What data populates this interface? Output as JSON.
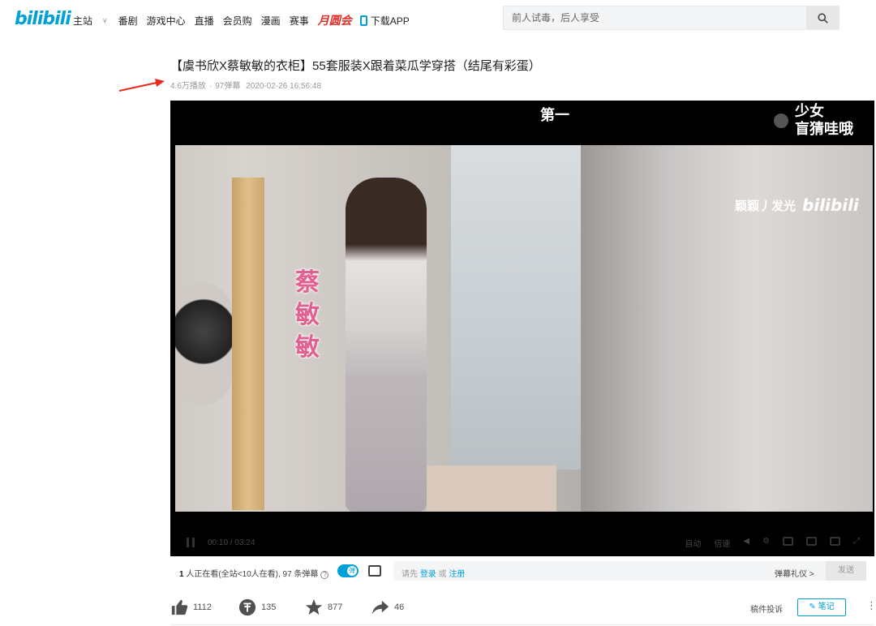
{
  "header": {
    "logo": "bilibili",
    "nav": [
      {
        "label": "主站",
        "has_dropdown": true
      },
      {
        "label": "番剧"
      },
      {
        "label": "游戏中心"
      },
      {
        "label": "直播"
      },
      {
        "label": "会员购"
      },
      {
        "label": "漫画"
      },
      {
        "label": "赛事"
      }
    ],
    "special_label": "月圆会",
    "download_label": "下载APP",
    "search_placeholder": "前人试毒，后人享受"
  },
  "video": {
    "title": "【虞书欣X蔡敏敏的衣柜】55套服装X跟着菜瓜学穿搭（结尾有彩蛋）",
    "views": "4.6万播放",
    "danmaku_count": "97弹幕",
    "date": "2020-02-26 16:56:48"
  },
  "player": {
    "caption_top": "第一",
    "caption_right_line1": "少女",
    "caption_right_line2": "盲猜哇哦",
    "watermark_text": "颖颖丿发光",
    "watermark_logo": "bilibili",
    "name_overlay": "蔡敏敏",
    "time_current": "00:10",
    "time_total": "03:24",
    "auto_label": "自动",
    "speed_label": "倍速"
  },
  "danmaku": {
    "viewers_count": "1",
    "viewers_text": "人正在看(全站<10人在看), 97 条弹幕",
    "toggle_label": "弹",
    "prompt_prefix": "请先",
    "login_label": "登录",
    "or_label": "或",
    "register_label": "注册",
    "etiquette_label": "弹幕礼仪 >",
    "send_label": "发送"
  },
  "actions": {
    "like_count": "1112",
    "coin_count": "135",
    "favorite_count": "877",
    "share_count": "46",
    "report_label": "稿件投诉",
    "note_label": "笔记"
  },
  "colors": {
    "brand": "#00a1d6",
    "annotation_arrow": "#e8291f"
  }
}
